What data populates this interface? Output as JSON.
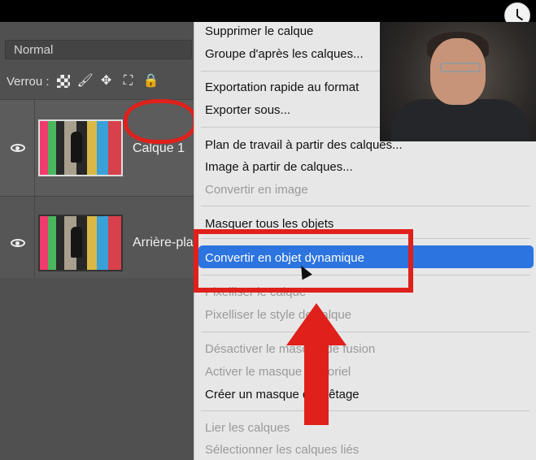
{
  "panel": {
    "blend_mode": "Normal",
    "lock_label": "Verrou :",
    "lock_icons": [
      "checker-icon",
      "brush-icon",
      "move-icon",
      "crop-icon",
      "padlock-icon"
    ],
    "layers": [
      {
        "name": "Calque 1"
      },
      {
        "name": "Arrière-pla"
      }
    ]
  },
  "menu": {
    "items": [
      {
        "label": "Supprimer le calque",
        "enabled": true
      },
      {
        "label": "Groupe d'après les calques...",
        "enabled": true
      },
      {
        "label": "Exportation rapide au format",
        "enabled": true
      },
      {
        "label": "Exporter sous...",
        "enabled": true
      },
      {
        "label": "Plan de travail à partir des calques...",
        "enabled": true
      },
      {
        "label": "Image à partir de calques...",
        "enabled": true
      },
      {
        "label": "Convertir en image",
        "enabled": false
      },
      {
        "label": "Masquer tous les objets",
        "enabled": true
      },
      {
        "label": "Convertir en objet dynamique",
        "enabled": true,
        "selected": true
      },
      {
        "label": "Pixelliser le calque",
        "enabled": false
      },
      {
        "label": "Pixelliser le style de calque",
        "enabled": false
      },
      {
        "label": "Désactiver le masque de fusion",
        "enabled": false
      },
      {
        "label": "Activer le masque vectoriel",
        "enabled": false
      },
      {
        "label": "Créer un masque d'écrêtage",
        "enabled": true
      },
      {
        "label": "Lier les calques",
        "enabled": false
      },
      {
        "label": "Sélectionner les calques liés",
        "enabled": false
      }
    ]
  },
  "colors": {
    "highlight": "#2c74e0",
    "annotation_red": "#e0201b"
  }
}
